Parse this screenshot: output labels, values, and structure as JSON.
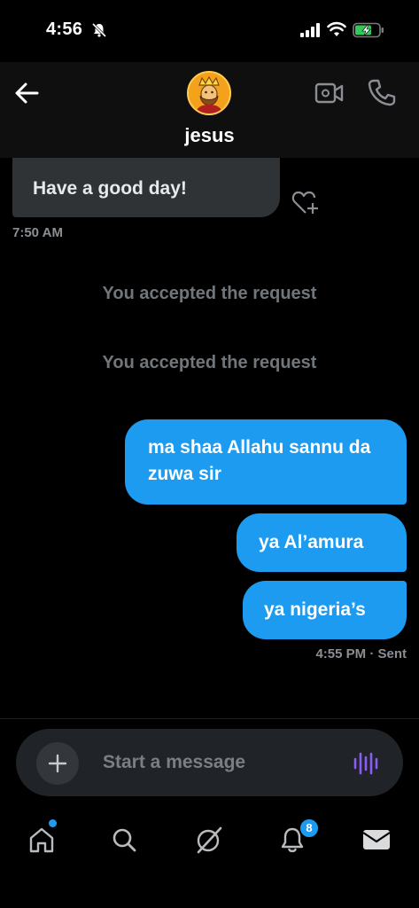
{
  "status_bar": {
    "time": "4:56",
    "icons": [
      "bell-slash-icon",
      "signal-icon",
      "wifi-icon",
      "battery-charging-icon"
    ]
  },
  "header": {
    "back_icon": "arrow-left-icon",
    "avatar_icon": "king-avatar-icon",
    "contact_name": "jesus",
    "video_icon": "video-camera-icon",
    "phone_icon": "phone-icon"
  },
  "messages": {
    "incoming": [
      {
        "text": "Have a good day!",
        "time": "7:50 AM"
      }
    ],
    "system": [
      "You accepted the request",
      "You accepted the request"
    ],
    "outgoing": [
      {
        "text": "ma shaa Allahu sannu da zuwa sir"
      },
      {
        "text": "ya Al’amura"
      },
      {
        "text": "ya nigeria’s"
      }
    ],
    "outgoing_status": "4:55 PM · Sent"
  },
  "composer": {
    "placeholder": "Start a message",
    "plus_icon": "plus-icon",
    "voice_icon": "voice-wave-icon"
  },
  "tab_bar": {
    "items": [
      "home-icon",
      "search-icon",
      "grok-icon",
      "bell-icon",
      "envelope-icon"
    ],
    "notification_count": "8"
  },
  "colors": {
    "accent": "#1d9bf0",
    "incoming_bubble": "#2f3336",
    "background": "#000000",
    "voice": "#8b5cf6"
  }
}
